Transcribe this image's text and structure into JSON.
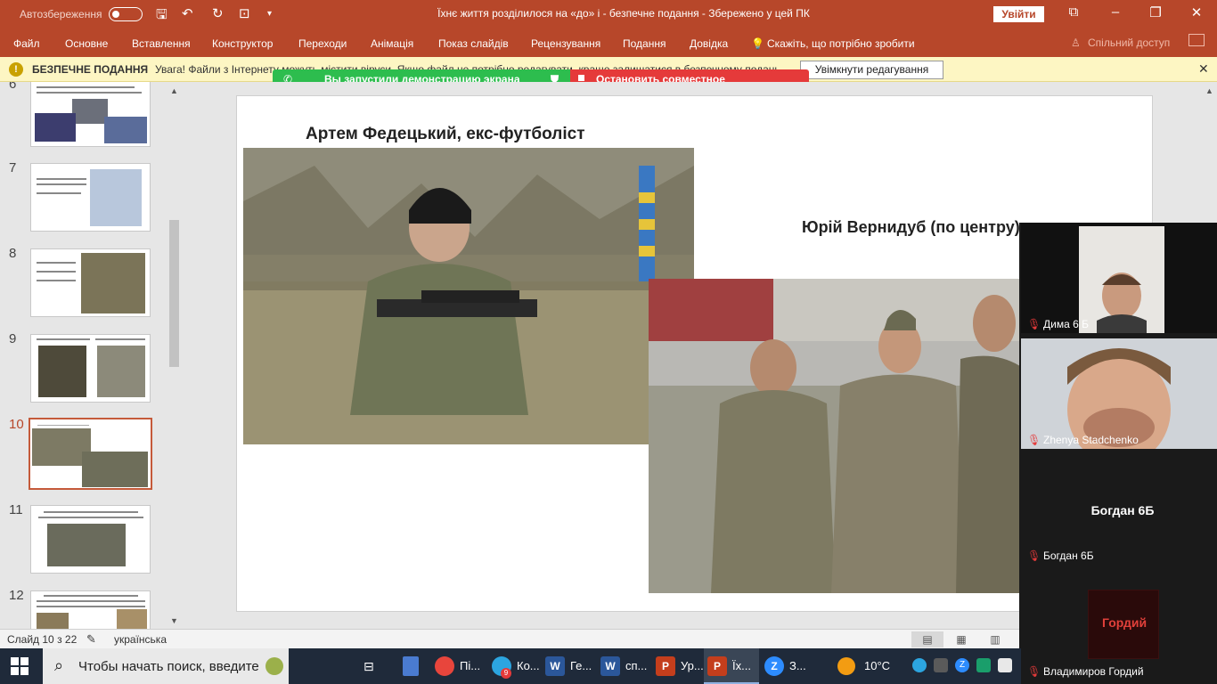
{
  "titlebar": {
    "autosave_label": "Автозбереження",
    "doc_title": "Їхнє життя розділилося на «до» і  - безпечне подання  -  Збережено у цей ПК",
    "signin_label": "Увійти",
    "accent_color": "#b7472a"
  },
  "ribbon": {
    "tabs": [
      "Файл",
      "Основне",
      "Вставлення",
      "Конструктор",
      "Переходи",
      "Анімація",
      "Показ слайдів",
      "Рецензування",
      "Подання",
      "Довідка"
    ],
    "tell_me": "Скажіть, що потрібно зробити",
    "share": "Спільний доступ"
  },
  "protected_view": {
    "heading": "БЕЗПЕЧНЕ ПОДАННЯ",
    "message": "Увага! Файли з Інтернету можуть містити віруси. Якщо файл не потрібно редагувати, краще залишатися в безпечному поданні.",
    "enable_button": "Увімкнути редагування"
  },
  "screen_share": {
    "status": "Вы запустили демонстрацию экрана",
    "stop_button": "Остановить совместное использование"
  },
  "thumbnails": {
    "numbers": [
      "6",
      "7",
      "8",
      "9",
      "10",
      "11",
      "12"
    ],
    "active": "10"
  },
  "slide": {
    "caption_left": "Артем Федецький, екс-футболіст",
    "caption_right": "Юрій Вернидуб (по центру)"
  },
  "statusbar": {
    "slide_info": "Слайд 10 з 22",
    "language": "українська"
  },
  "zoom": {
    "participants": [
      {
        "name": "Дима 6 Б"
      },
      {
        "name": "Zhenya Stadchenko"
      },
      {
        "name": "Богдан 6Б",
        "display_text": "Богдан 6Б"
      },
      {
        "name": "Владимиров Гордий",
        "logo_text": "Гордий"
      }
    ]
  },
  "taskbar": {
    "search_placeholder": "Чтобы начать поиск, введите",
    "items": [
      {
        "label": "Пі...",
        "icon": "chrome-icon",
        "color": "#e8453c"
      },
      {
        "label": "Ко...",
        "icon": "telegram-icon",
        "color": "#2ca5e0",
        "badge": "9"
      },
      {
        "label": "Ге...",
        "icon": "word-icon",
        "color": "#2b579a"
      },
      {
        "label": "сп...",
        "icon": "word-icon",
        "color": "#2b579a"
      },
      {
        "label": "Ур...",
        "icon": "powerpoint-icon",
        "color": "#c43e1c"
      },
      {
        "label": "Їх...",
        "icon": "powerpoint-icon",
        "color": "#c43e1c"
      },
      {
        "label": "З...",
        "icon": "zoom-icon",
        "color": "#2d8cff"
      }
    ],
    "weather": "10°C"
  }
}
